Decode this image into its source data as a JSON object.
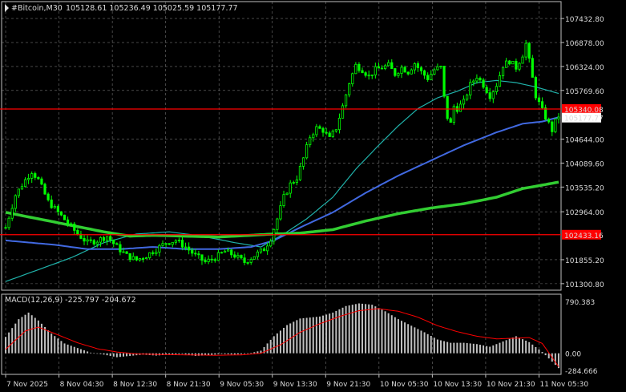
{
  "header": {
    "symbol": "#Bitcoin,M30",
    "ohlc": "105128.61 105236.49 105025.59 105177.77",
    "icon": "chart-arrow-icon"
  },
  "price_axis": {
    "labels": [
      "107432.80",
      "106878.00",
      "106324.00",
      "105769.60",
      "105340.08",
      "105177.77",
      "104644.00",
      "104089.60",
      "103535.20",
      "102964.00",
      "102433.16",
      "101855.20",
      "101300.80"
    ],
    "ticks": [
      107432.8,
      106878.0,
      106324.0,
      105769.6,
      104644.0,
      104089.6,
      103535.2,
      102964.0,
      101855.2,
      101300.8
    ]
  },
  "levels": [
    {
      "price": 105340.08,
      "label": "105340.08",
      "color": "#ff0000"
    },
    {
      "price": 102433.16,
      "label": "102433.16",
      "color": "#ff0000"
    }
  ],
  "current_price": {
    "value": 105177.77,
    "label": "105177.77"
  },
  "macd": {
    "label": "MACD(12,26,9) -225.797 -204.672",
    "axis_labels": [
      "790.383",
      "0.00",
      "-284.666"
    ],
    "range": [
      -284.666,
      790.383
    ]
  },
  "time_axis": [
    "7 Nov 2025",
    "8 Nov 04:30",
    "8 Nov 12:30",
    "8 Nov 21:30",
    "9 Nov 05:30",
    "9 Nov 13:30",
    "9 Nov 21:30",
    "10 Nov 05:30",
    "10 Nov 13:30",
    "10 Nov 21:30",
    "11 Nov 05:30"
  ],
  "colors": {
    "background": "#000000",
    "candle": "#00ff00",
    "ma_fast": "#20b2aa",
    "ma_mid": "#4169e1",
    "ma_slow": "#32cd32",
    "macd_hist": "#c0c0c0",
    "macd_signal": "#ff0000",
    "grid": "#c0c0c0"
  },
  "chart_data": {
    "type": "candlestick",
    "title": "#Bitcoin,M30",
    "ylim": [
      101150,
      107750
    ],
    "y_axis_side": "right",
    "grid": true,
    "anchors": [
      [
        0,
        102600
      ],
      [
        3,
        103350
      ],
      [
        6,
        103700
      ],
      [
        8,
        103900
      ],
      [
        10,
        103700
      ],
      [
        13,
        103200
      ],
      [
        16,
        102950
      ],
      [
        19,
        102700
      ],
      [
        22,
        102450
      ],
      [
        25,
        102250
      ],
      [
        28,
        102300
      ],
      [
        31,
        102400
      ],
      [
        34,
        102150
      ],
      [
        37,
        101950
      ],
      [
        40,
        101850
      ],
      [
        43,
        101950
      ],
      [
        46,
        102100
      ],
      [
        49,
        102250
      ],
      [
        52,
        102300
      ],
      [
        55,
        102150
      ],
      [
        58,
        101950
      ],
      [
        61,
        101800
      ],
      [
        64,
        101900
      ],
      [
        67,
        102050
      ],
      [
        70,
        101950
      ],
      [
        73,
        101800
      ],
      [
        76,
        101950
      ],
      [
        79,
        102100
      ],
      [
        81,
        102350
      ],
      [
        83,
        102800
      ],
      [
        85,
        103300
      ],
      [
        87,
        103600
      ],
      [
        89,
        103750
      ],
      [
        91,
        104200
      ],
      [
        93,
        104700
      ],
      [
        95,
        104900
      ],
      [
        97,
        104850
      ],
      [
        99,
        104650
      ],
      [
        101,
        104900
      ],
      [
        103,
        105400
      ],
      [
        105,
        105950
      ],
      [
        107,
        106350
      ],
      [
        109,
        106250
      ],
      [
        111,
        106100
      ],
      [
        113,
        106250
      ],
      [
        115,
        106300
      ],
      [
        117,
        106350
      ],
      [
        119,
        106150
      ],
      [
        121,
        106300
      ],
      [
        123,
        106200
      ],
      [
        125,
        106400
      ],
      [
        127,
        106200
      ],
      [
        129,
        106050
      ],
      [
        131,
        106250
      ],
      [
        133,
        106300
      ],
      [
        134,
        105600
      ],
      [
        135,
        105150
      ],
      [
        136,
        105000
      ],
      [
        137,
        105400
      ],
      [
        138,
        105350
      ],
      [
        140,
        105500
      ],
      [
        142,
        105900
      ],
      [
        144,
        106100
      ],
      [
        146,
        105900
      ],
      [
        148,
        105650
      ],
      [
        150,
        105900
      ],
      [
        152,
        106350
      ],
      [
        154,
        106450
      ],
      [
        156,
        106300
      ],
      [
        158,
        106600
      ],
      [
        159,
        106850
      ],
      [
        160,
        106450
      ],
      [
        161,
        106050
      ],
      [
        162,
        105650
      ],
      [
        164,
        105300
      ],
      [
        166,
        105000
      ],
      [
        167,
        104850
      ],
      [
        168,
        105050
      ],
      [
        169,
        105180
      ]
    ],
    "ma_fast": [
      [
        0,
        101350
      ],
      [
        20,
        101900
      ],
      [
        30,
        102250
      ],
      [
        40,
        102450
      ],
      [
        50,
        102500
      ],
      [
        60,
        102400
      ],
      [
        70,
        102250
      ],
      [
        78,
        102150
      ],
      [
        85,
        102450
      ],
      [
        92,
        102800
      ],
      [
        100,
        103300
      ],
      [
        107,
        103950
      ],
      [
        114,
        104500
      ],
      [
        120,
        104950
      ],
      [
        126,
        105350
      ],
      [
        132,
        105600
      ],
      [
        138,
        105750
      ],
      [
        144,
        105950
      ],
      [
        150,
        106000
      ],
      [
        156,
        105950
      ],
      [
        162,
        105850
      ],
      [
        169,
        105700
      ]
    ],
    "ma_mid": [
      [
        0,
        102300
      ],
      [
        15,
        102200
      ],
      [
        25,
        102100
      ],
      [
        35,
        102100
      ],
      [
        45,
        102150
      ],
      [
        55,
        102100
      ],
      [
        65,
        102100
      ],
      [
        75,
        102150
      ],
      [
        82,
        102300
      ],
      [
        90,
        102600
      ],
      [
        100,
        102950
      ],
      [
        110,
        103400
      ],
      [
        120,
        103800
      ],
      [
        130,
        104150
      ],
      [
        140,
        104500
      ],
      [
        150,
        104800
      ],
      [
        158,
        105000
      ],
      [
        164,
        105050
      ],
      [
        169,
        105150
      ]
    ],
    "ma_slow": [
      [
        0,
        102950
      ],
      [
        10,
        102800
      ],
      [
        20,
        102650
      ],
      [
        30,
        102500
      ],
      [
        38,
        102400
      ],
      [
        45,
        102420
      ],
      [
        55,
        102400
      ],
      [
        65,
        102380
      ],
      [
        75,
        102420
      ],
      [
        82,
        102450
      ],
      [
        90,
        102470
      ],
      [
        100,
        102550
      ],
      [
        110,
        102750
      ],
      [
        120,
        102920
      ],
      [
        130,
        103050
      ],
      [
        140,
        103150
      ],
      [
        150,
        103300
      ],
      [
        158,
        103500
      ],
      [
        164,
        103580
      ],
      [
        169,
        103650
      ]
    ],
    "macd_hist": [
      [
        0,
        250
      ],
      [
        4,
        520
      ],
      [
        7,
        620
      ],
      [
        10,
        500
      ],
      [
        14,
        300
      ],
      [
        18,
        150
      ],
      [
        22,
        80
      ],
      [
        26,
        10
      ],
      [
        30,
        -20
      ],
      [
        34,
        -60
      ],
      [
        38,
        -40
      ],
      [
        42,
        -20
      ],
      [
        46,
        -35
      ],
      [
        50,
        -20
      ],
      [
        54,
        -10
      ],
      [
        58,
        -40
      ],
      [
        62,
        -30
      ],
      [
        66,
        -10
      ],
      [
        70,
        -20
      ],
      [
        74,
        -5
      ],
      [
        78,
        40
      ],
      [
        82,
        260
      ],
      [
        86,
        430
      ],
      [
        90,
        530
      ],
      [
        96,
        560
      ],
      [
        100,
        620
      ],
      [
        104,
        720
      ],
      [
        108,
        760
      ],
      [
        112,
        740
      ],
      [
        116,
        640
      ],
      [
        120,
        520
      ],
      [
        124,
        420
      ],
      [
        128,
        320
      ],
      [
        132,
        210
      ],
      [
        136,
        160
      ],
      [
        140,
        160
      ],
      [
        144,
        140
      ],
      [
        148,
        100
      ],
      [
        152,
        180
      ],
      [
        156,
        260
      ],
      [
        160,
        170
      ],
      [
        164,
        20
      ],
      [
        169,
        -226
      ]
    ],
    "macd_signal": [
      [
        0,
        60
      ],
      [
        6,
        340
      ],
      [
        10,
        400
      ],
      [
        16,
        280
      ],
      [
        22,
        160
      ],
      [
        28,
        70
      ],
      [
        34,
        20
      ],
      [
        40,
        -10
      ],
      [
        48,
        -20
      ],
      [
        56,
        -25
      ],
      [
        64,
        -30
      ],
      [
        72,
        -25
      ],
      [
        78,
        0
      ],
      [
        84,
        130
      ],
      [
        90,
        320
      ],
      [
        96,
        450
      ],
      [
        102,
        560
      ],
      [
        108,
        650
      ],
      [
        114,
        680
      ],
      [
        120,
        640
      ],
      [
        126,
        550
      ],
      [
        132,
        420
      ],
      [
        138,
        330
      ],
      [
        144,
        260
      ],
      [
        150,
        220
      ],
      [
        156,
        230
      ],
      [
        160,
        240
      ],
      [
        164,
        150
      ],
      [
        169,
        -205
      ]
    ]
  }
}
